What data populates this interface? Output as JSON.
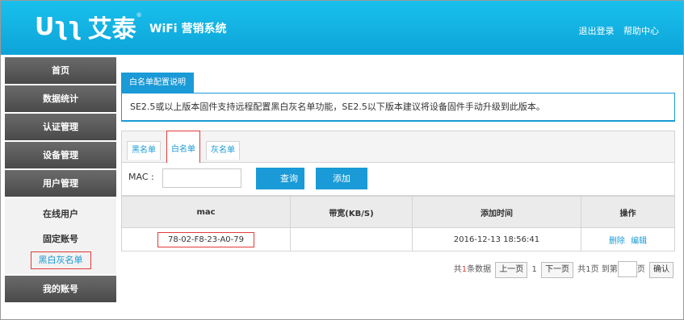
{
  "header": {
    "logo_mark": "Uʅʅ",
    "logo_text": "艾泰",
    "logo_tm": "®",
    "system_title": "WiFi 营销系统",
    "logout": "退出登录",
    "help": "帮助中心"
  },
  "sidebar": {
    "items": [
      {
        "label": "首页"
      },
      {
        "label": "数据统计"
      },
      {
        "label": "认证管理"
      },
      {
        "label": "设备管理"
      },
      {
        "label": "用户管理"
      }
    ],
    "sub_items": [
      {
        "label": "在线用户"
      },
      {
        "label": "固定账号"
      },
      {
        "label": "黑白灰名单"
      }
    ],
    "last_item": "我的账号"
  },
  "main": {
    "section_tab": "白名单配置说明",
    "info_text": "SE2.5或以上版本固件支持远程配置黑白灰名单功能，SE2.5以下版本建议将设备固件手动升级到此版本。",
    "tabs": [
      {
        "label": "黑名单"
      },
      {
        "label": "白名单"
      },
      {
        "label": "灰名单"
      }
    ],
    "mac_label": "MAC :",
    "mac_value": "",
    "query_button": "查询",
    "add_button": "添加",
    "table": {
      "headers": [
        "mac",
        "带宽(KB/S)",
        "添加时间",
        "操作"
      ],
      "rows": [
        {
          "mac": "78-02-F8-23-A0-79",
          "bandwidth": "",
          "time": "2016-12-13 18:56:41",
          "delete": "删除",
          "edit": "编辑"
        }
      ]
    },
    "pager": {
      "total_prefix": "共",
      "total_count": "1",
      "total_suffix": "条数据",
      "prev": "上一页",
      "current": "1",
      "next": "下一页",
      "pages": "共1页",
      "goto_prefix": "到第",
      "goto_suffix": "页",
      "confirm": "确认"
    }
  },
  "colors": {
    "header": "#0da4d9",
    "accent": "#1a9ad6",
    "highlight": "#e23a3a",
    "nav": "#4a4a4a"
  }
}
